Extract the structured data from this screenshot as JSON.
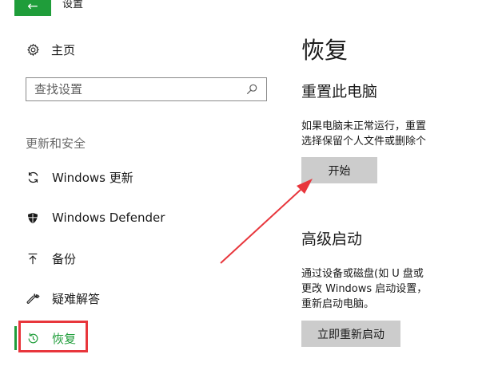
{
  "window": {
    "title": "设置",
    "back_glyph": "←"
  },
  "sidebar": {
    "home_label": "主页",
    "search": {
      "placeholder": "查找设置",
      "value": ""
    },
    "section_heading": "更新和安全",
    "items": [
      {
        "label": "Windows 更新",
        "icon": "refresh-icon"
      },
      {
        "label": "Windows Defender",
        "icon": "shield-icon"
      },
      {
        "label": "备份",
        "icon": "backup-icon"
      },
      {
        "label": "疑难解答",
        "icon": "wrench-icon"
      },
      {
        "label": "恢复",
        "icon": "history-icon",
        "selected": true
      }
    ]
  },
  "main": {
    "title": "恢复",
    "reset": {
      "heading": "重置此电脑",
      "desc_lines": [
        "如果电脑未正常运行，重置",
        "选择保留个人文件或删除个"
      ],
      "button_label": "开始"
    },
    "advanced": {
      "heading": "高级启动",
      "desc_lines": [
        "通过设备或磁盘(如 U 盘或",
        "更改 Windows 启动设置，",
        "重新启动电脑。"
      ],
      "button_label": "立即重新启动"
    }
  },
  "colors": {
    "accent": "#1f9d3a",
    "annotation": "#e8363c",
    "button_bg": "#cccccc"
  }
}
